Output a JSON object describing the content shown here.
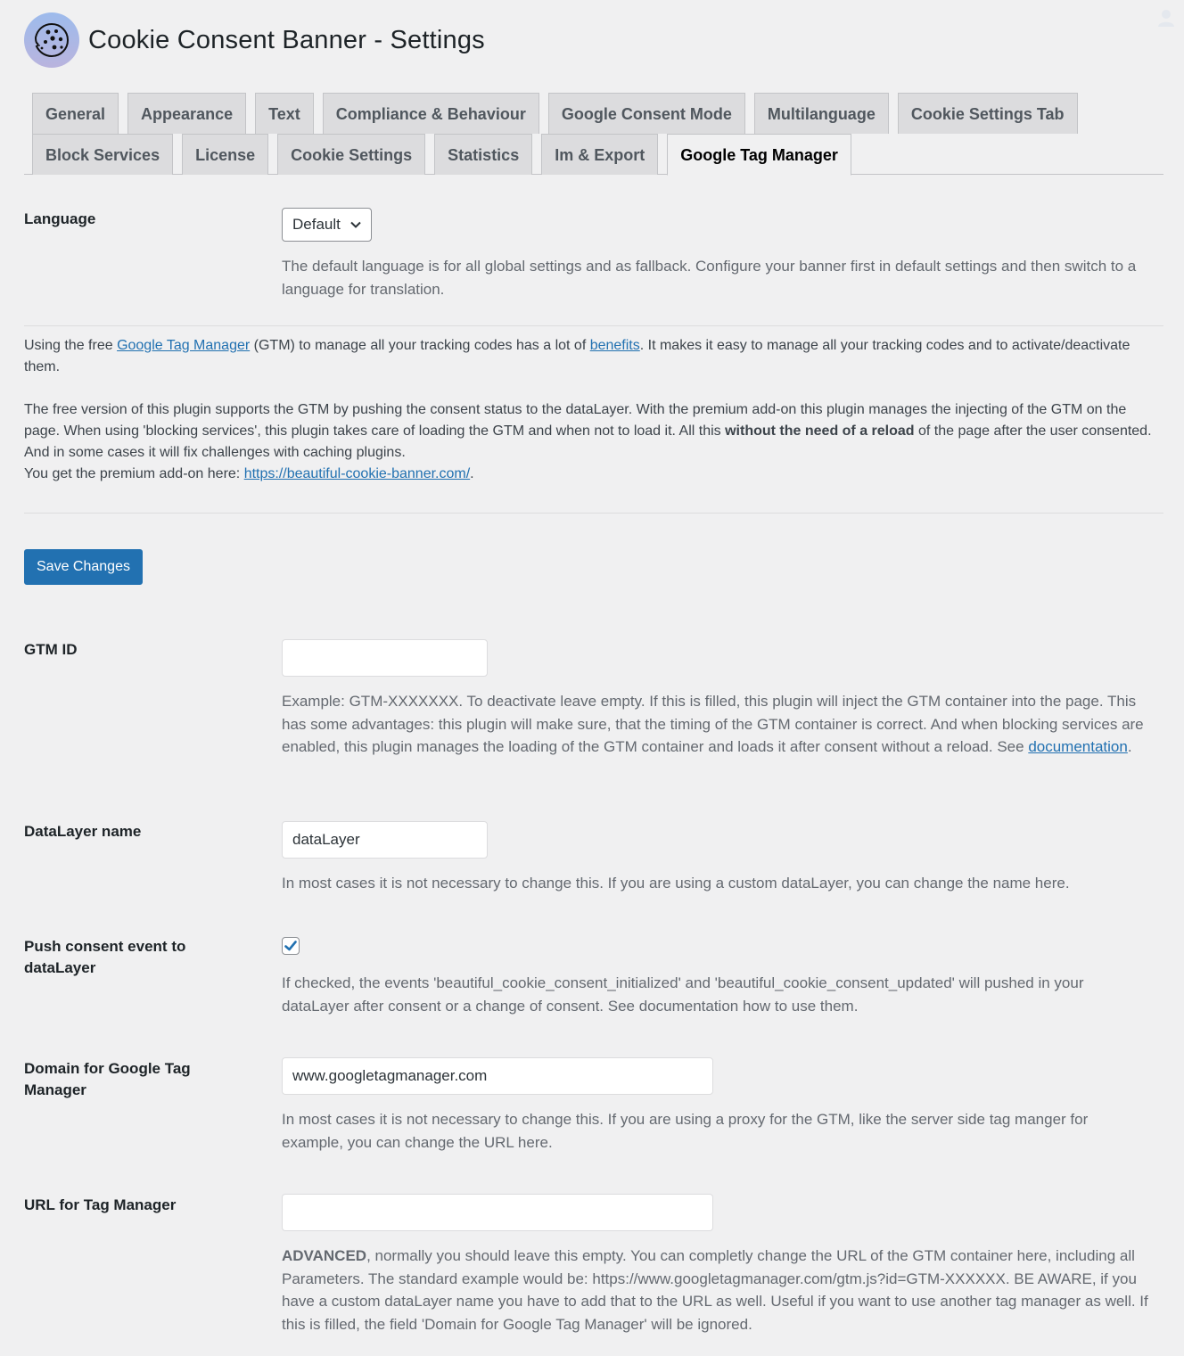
{
  "header": {
    "title": "Cookie Consent Banner - Settings",
    "logo_icon": "cookie-icon",
    "user_icon": "user-avatar-icon"
  },
  "tabs": {
    "row1": [
      {
        "label": "General",
        "active": false
      },
      {
        "label": "Appearance",
        "active": false
      },
      {
        "label": "Text",
        "active": false
      },
      {
        "label": "Compliance & Behaviour",
        "active": false
      },
      {
        "label": "Google Consent Mode",
        "active": false
      },
      {
        "label": "Multilanguage",
        "active": false
      },
      {
        "label": "Cookie Settings Tab",
        "active": false
      }
    ],
    "row2": [
      {
        "label": "Block Services",
        "active": false
      },
      {
        "label": "License",
        "active": false
      },
      {
        "label": "Cookie Settings",
        "active": false
      },
      {
        "label": "Statistics",
        "active": false
      },
      {
        "label": "Im & Export",
        "active": false
      },
      {
        "label": "Google Tag Manager",
        "active": true
      }
    ]
  },
  "language": {
    "label": "Language",
    "selected": "Default",
    "description": "The default language is for all global settings and as fallback. Configure your banner first in default settings and then switch to a language for translation."
  },
  "intro": {
    "p1_before": "Using the free ",
    "p1_link1": "Google Tag Manager",
    "p1_middle": " (GTM) to manage all your tracking codes has a lot of ",
    "p1_link2": "benefits",
    "p1_after": ". It makes it easy to manage all your tracking codes and to activate/deactivate them.",
    "p2_before": "The free version of this plugin supports the GTM by pushing the consent status to the dataLayer. With the premium add-on this plugin manages the injecting of the GTM on the page. When using 'blocking services', this plugin takes care of loading the GTM and when not to load it. All this ",
    "p2_bold": "without the need of a reload",
    "p2_after": " of the page after the user consented. And in some cases it will fix challenges with caching plugins.",
    "p3_before": "You get the premium add-on here: ",
    "p3_link": "https://beautiful-cookie-banner.com/",
    "p3_after": "."
  },
  "save_button": "Save Changes",
  "fields": {
    "gtm_id": {
      "label": "GTM ID",
      "value": "",
      "description_before": "Example: GTM-XXXXXXX. To deactivate leave empty. If this is filled, this plugin will inject the GTM container into the page. This has some advantages: this plugin will make sure, that the timing of the GTM container is correct. And when blocking services are enabled, this plugin manages the loading of the GTM container and loads it after consent without a reload. See ",
      "description_link": "documentation",
      "description_after": "."
    },
    "datalayer_name": {
      "label": "DataLayer name",
      "value": "dataLayer",
      "description": "In most cases it is not necessary to change this. If you are using a custom dataLayer, you can change the name here."
    },
    "push_consent": {
      "label": "Push consent event to dataLayer",
      "checked": true,
      "description": "If checked, the events 'beautiful_cookie_consent_initialized' and 'beautiful_cookie_consent_updated' will pushed in your dataLayer after consent or a change of consent. See documentation how to use them."
    },
    "gtm_domain": {
      "label": "Domain for Google Tag Manager",
      "value": "www.googletagmanager.com",
      "description": "In most cases it is not necessary to change this. If you are using a proxy for the GTM, like the server side tag manger for example, you can change the URL here."
    },
    "gtm_url": {
      "label": "URL for Tag Manager",
      "value": "",
      "description_bold": "ADVANCED",
      "description": ", normally you should leave this empty. You can completly change the URL of the GTM container here, including all Parameters. The standard example would be: https://www.googletagmanager.com/gtm.js?id=GTM-XXXXXX. BE AWARE, if you have a custom dataLayer name you have to add that to the URL as well. Useful if you want to use another tag manager as well. If this is filled, the field 'Domain for Google Tag Manager' will be ignored."
    }
  },
  "colors": {
    "accent": "#2271b1",
    "background": "#f0f0f1",
    "tab_inactive": "#dcdcde"
  }
}
